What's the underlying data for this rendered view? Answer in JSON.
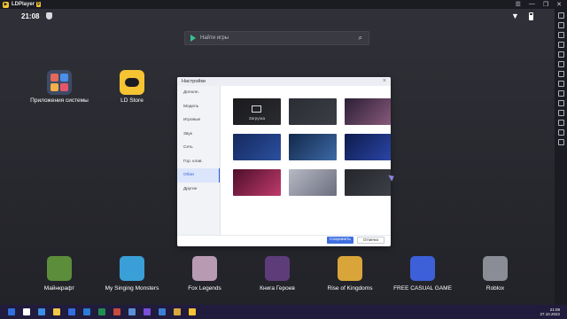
{
  "window": {
    "app_name": "LDPlayer",
    "version_badge": "9",
    "controls": [
      "☰",
      "—",
      "❐",
      "✕"
    ]
  },
  "status": {
    "time": "21:08"
  },
  "search": {
    "placeholder": "Найти игры"
  },
  "desktop": [
    {
      "label": "Приложения системы",
      "icon": "system-apps-icon"
    },
    {
      "label": "LD Store",
      "icon": "ld-store-icon"
    }
  ],
  "dialog": {
    "title": "Настройки",
    "nav": [
      "Дополн.",
      "Модель",
      "Игровые",
      "Звук",
      "Сеть",
      "Гор. клав.",
      "Обои",
      "Другие"
    ],
    "active_nav": "Обои",
    "wallpapers": [
      {
        "label": "Загрузка",
        "color1": "#1a1a1d",
        "color2": "#2b2c30"
      },
      {
        "label": "",
        "color1": "#2c2e34",
        "color2": "#3a3d45"
      },
      {
        "label": "",
        "color1": "#2b1f34",
        "color2": "#8a5a7d"
      },
      {
        "label": "",
        "color1": "#142a5e",
        "color2": "#2c4f9e"
      },
      {
        "label": "",
        "color1": "#13284a",
        "color2": "#3c6aa6"
      },
      {
        "label": "",
        "color1": "#0d1b4c",
        "color2": "#2c46a8"
      },
      {
        "label": "",
        "color1": "#4d0f2a",
        "color2": "#c03a6c"
      },
      {
        "label": "",
        "color1": "#b7b9c4",
        "color2": "#6b6e7e"
      },
      {
        "label": "",
        "color1": "#24262b",
        "color2": "#3d4047"
      }
    ],
    "save_label": "Сохранить",
    "cancel_label": "Отмена"
  },
  "dock": [
    {
      "label": "Майнкрафт",
      "color": "#5c8d3a"
    },
    {
      "label": "My Singing Monsters",
      "color": "#3a9fd6"
    },
    {
      "label": "Fox Legends",
      "color": "#b99ab3"
    },
    {
      "label": "Книга Героев",
      "color": "#5e3c7a"
    },
    {
      "label": "Rise of Kingdoms",
      "color": "#d9a53a"
    },
    {
      "label": "FREE CASUAL GAME",
      "color": "#3d5fd8"
    },
    {
      "label": "Roblox",
      "color": "#8a8d96"
    }
  ],
  "taskbar": {
    "time": "21:08",
    "date": "27.10.2022",
    "apps": [
      "#2f6fe0",
      "#ffffff",
      "#3a8ee6",
      "#f2c744",
      "#2f6fe0",
      "#2b7bd8",
      "#1f8f4f",
      "#c84a3a",
      "#5a8fd8",
      "#7a4fd8",
      "#3c7fd6",
      "#d8a83a",
      "#f6c333"
    ]
  },
  "colors": {
    "accent": "#3f6fe0",
    "ld_yellow": "#f6c333"
  }
}
